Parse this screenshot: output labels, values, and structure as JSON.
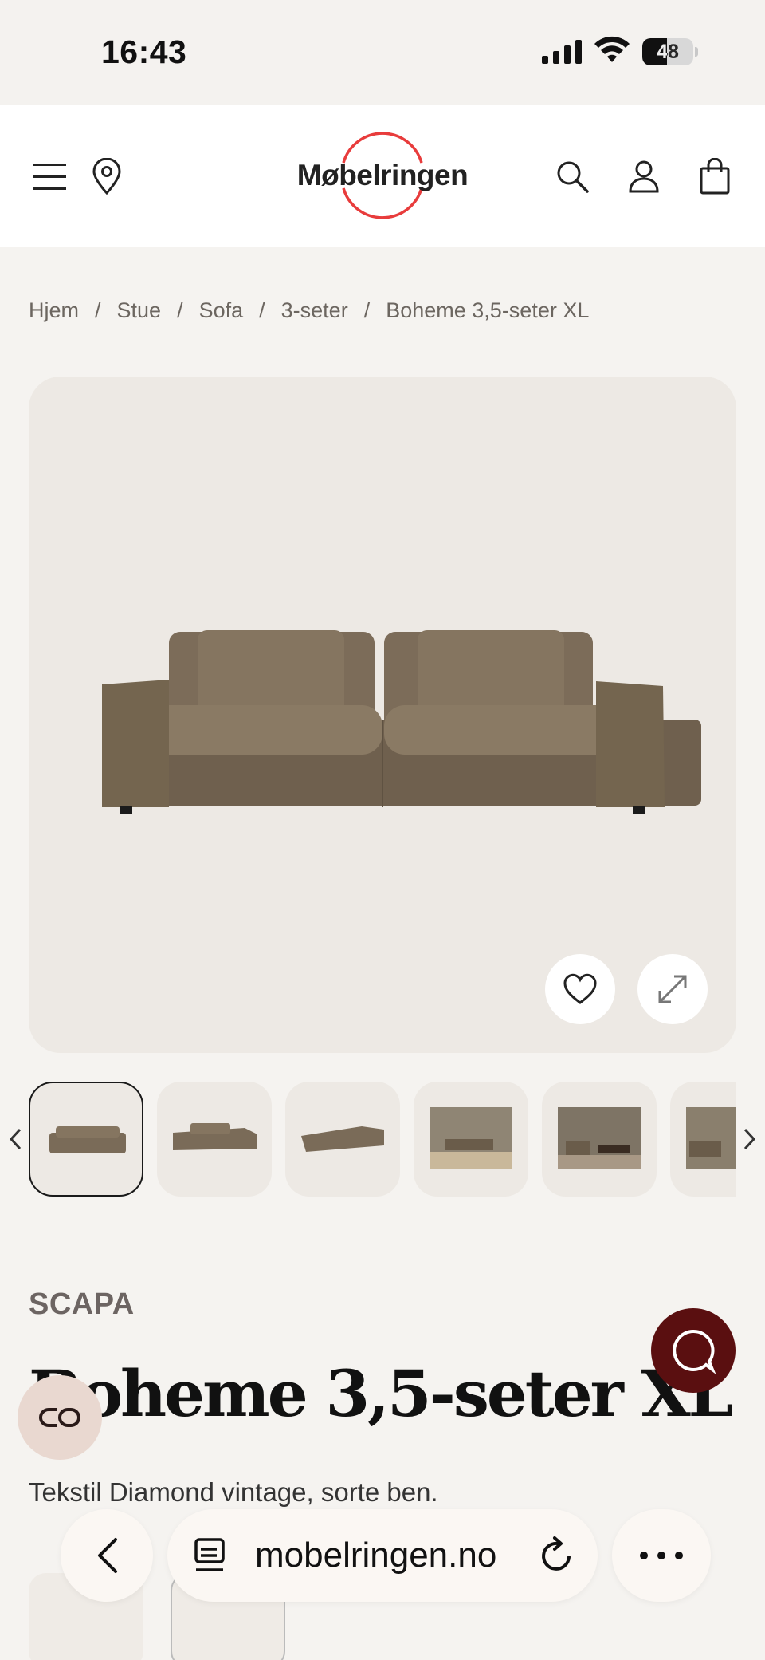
{
  "status_bar": {
    "time": "16:43",
    "battery": "48",
    "battery_level": 0.48
  },
  "header": {
    "logo_text": "Møbelringen",
    "icons": [
      "menu-icon",
      "location-pin-icon",
      "search-icon",
      "account-icon",
      "cart-icon"
    ]
  },
  "breadcrumb": {
    "items": [
      "Hjem",
      "Stue",
      "Sofa",
      "3-seter",
      "Boheme 3,5-seter XL"
    ],
    "separator": "/"
  },
  "gallery": {
    "image_alt": "sofa",
    "icons": [
      "heart-icon",
      "expand-icon",
      "chevron-left-icon",
      "chevron-right-icon"
    ],
    "thumbnail_count": 6
  },
  "product": {
    "brand": "SCAPA",
    "title": "Boheme 3,5-seter XL",
    "subtitle": "Tekstil Diamond vintage, sorte ben."
  },
  "floating": {
    "icons": [
      "chat-icon",
      "compare-icon"
    ]
  },
  "browser": {
    "url": "mobelringen.no",
    "icons": [
      "back-icon",
      "tabs-icon",
      "reload-icon",
      "more-icon"
    ]
  },
  "colors": {
    "page_bg": "#f5f3f0",
    "gallery_bg": "#ede9e4",
    "logo_ring": "#e83c3c",
    "chat_button": "#5a0f10",
    "compare_button": "#e9d8d0",
    "sofa": "#7a6b58"
  }
}
